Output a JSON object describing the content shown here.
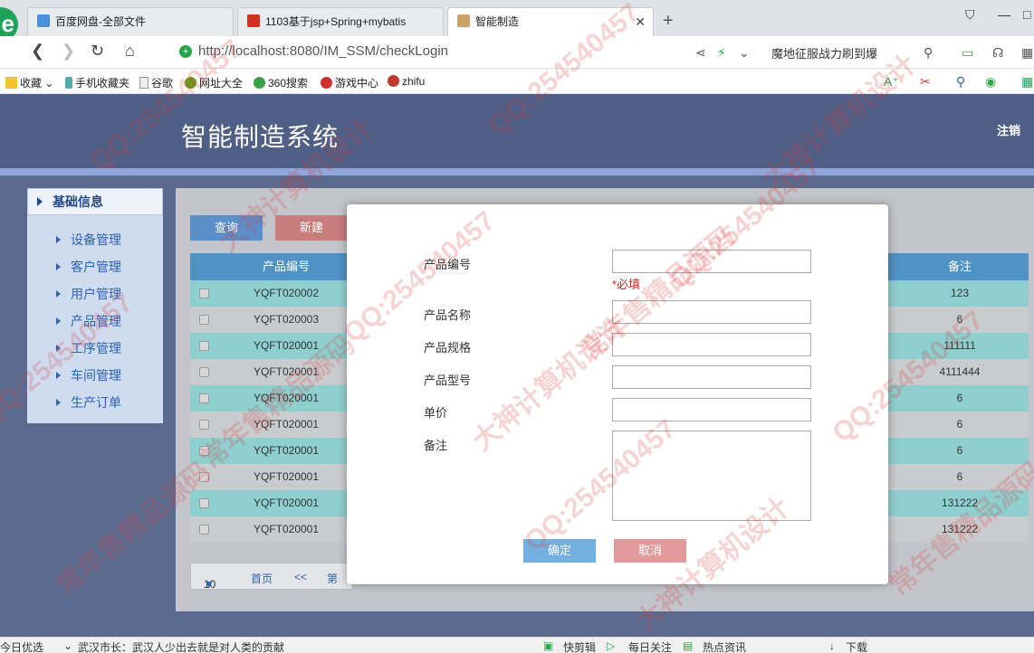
{
  "browser": {
    "tabs": [
      {
        "label": "百度网盘-全部文件",
        "active": false
      },
      {
        "label": "1103基于jsp+Spring+mybatis",
        "active": false
      },
      {
        "label": "智能制造",
        "active": true
      }
    ],
    "url_host": "http://localhost",
    "url_path": ":8080/IM_SSM/checkLogin",
    "search_hint": "魔地征服战力刷到爆",
    "bookmarks": [
      "收藏",
      "手机收藏夹",
      "谷歌",
      "网址大全",
      "360搜索",
      "游戏中心",
      "zhifu"
    ]
  },
  "header": {
    "title": "智能制造系统",
    "logout": "注销"
  },
  "sidebar": {
    "section": "基础信息",
    "items": [
      "设备管理",
      "客户管理",
      "用户管理",
      "产品管理",
      "工序管理",
      "车间管理",
      "生产订单"
    ]
  },
  "toolbar": {
    "query": "查询",
    "new": "新建"
  },
  "grid": {
    "columns": {
      "code": "产品编号",
      "remark": "备注"
    },
    "rows": [
      {
        "code": "YQFT020002",
        "remark": "123"
      },
      {
        "code": "YQFT020003",
        "remark": "6"
      },
      {
        "code": "YQFT020001",
        "remark": "111111"
      },
      {
        "code": "YQFT020001",
        "remark": "4111444"
      },
      {
        "code": "YQFT020001",
        "remark": "6"
      },
      {
        "code": "YQFT020001",
        "remark": "6"
      },
      {
        "code": "YQFT020001",
        "remark": "6"
      },
      {
        "code": "YQFT020001",
        "remark": "6"
      },
      {
        "code": "YQFT020001",
        "remark": "131222"
      },
      {
        "code": "YQFT020001",
        "remark": "131222"
      }
    ]
  },
  "pager": {
    "page_size": "10",
    "first": "首页",
    "prev": "<<",
    "page": "第"
  },
  "modal": {
    "fields": {
      "code": "产品编号",
      "name": "产品名称",
      "spec": "产品规格",
      "model": "产品型号",
      "price": "单价",
      "remark": "备注"
    },
    "required": "*必填",
    "ok": "确定",
    "cancel": "取消"
  },
  "statusbar": {
    "left": "今日优选",
    "news": "武汉市长：武汉人少出去就是对人类的贡献",
    "items": [
      "快剪辑",
      "每日关注",
      "热点资讯",
      "下载"
    ]
  },
  "watermarks": [
    "QQ:254540457",
    "大神计算机设计",
    "常年售精品源码"
  ]
}
